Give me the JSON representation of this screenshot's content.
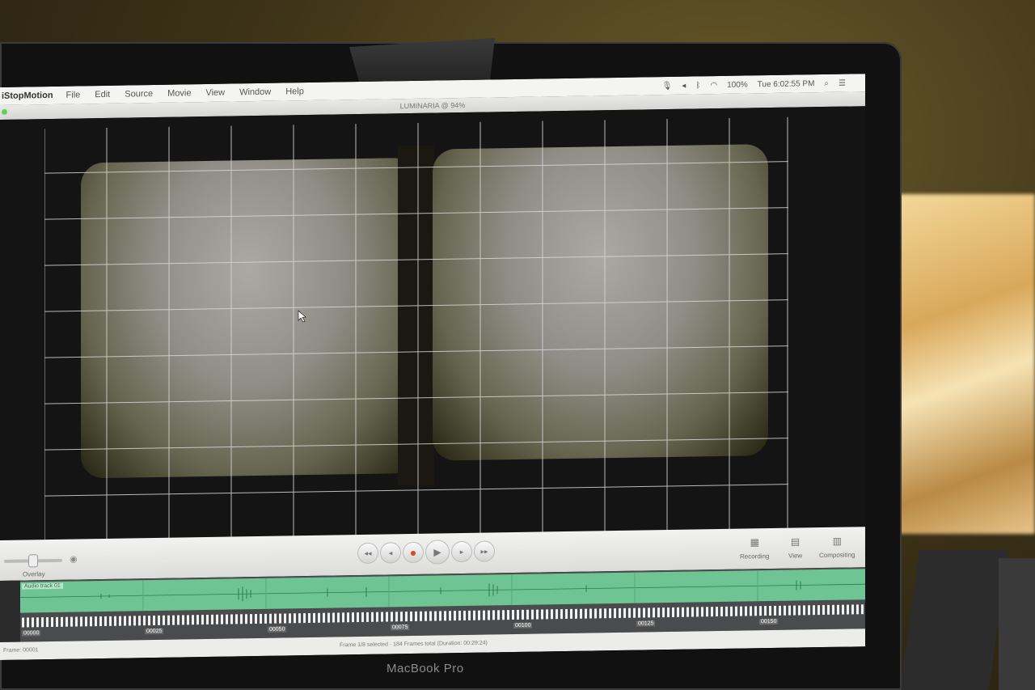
{
  "menubar": {
    "app_name": "iStopMotion",
    "items": [
      "File",
      "Edit",
      "Source",
      "Movie",
      "View",
      "Window",
      "Help"
    ],
    "battery": "100%",
    "clock": "Tue 6:02:55 PM"
  },
  "window": {
    "title": "LUMINARIA @ 94%"
  },
  "controls": {
    "overlay_label": "Overlay",
    "tools": [
      "Recording",
      "View",
      "Compositing"
    ]
  },
  "timeline": {
    "audio_track_label": "Audio track 01",
    "frame_markers": [
      "00000",
      "00025",
      "00050",
      "00075",
      "00100",
      "00125",
      "00150"
    ]
  },
  "status": {
    "left": "Frame: 00001",
    "center": "Frame 1/8 selected · 184 Frames total (Duration: 00:29:24)"
  },
  "laptop_brand": "MacBook Pro",
  "colors": {
    "audio_track": "#6fc494",
    "record": "#e0452c",
    "grid_line": "#d8d8d8"
  }
}
